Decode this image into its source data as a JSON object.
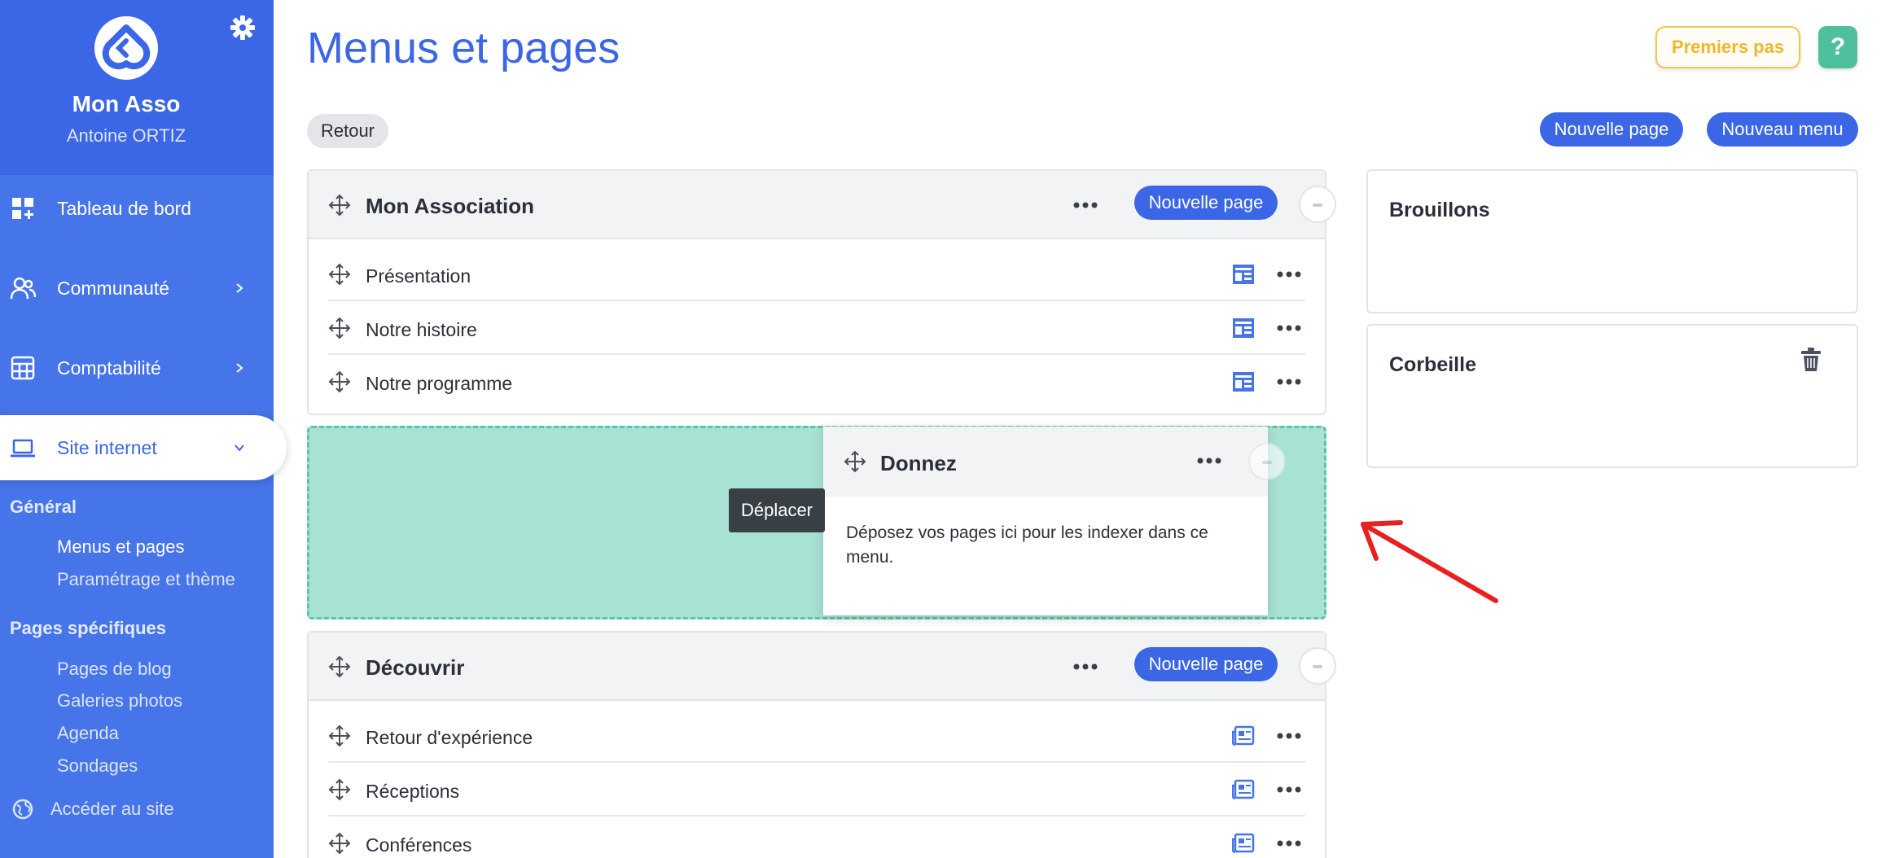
{
  "sidebar": {
    "org_name": "Mon Asso",
    "user_name": "Antoine ORTIZ",
    "nav": [
      {
        "label": "Tableau de bord",
        "icon": "dashboard-icon"
      },
      {
        "label": "Communauté",
        "icon": "community-icon"
      },
      {
        "label": "Comptabilité",
        "icon": "calculator-icon"
      },
      {
        "label": "Site internet",
        "icon": "laptop-icon"
      }
    ],
    "sections": [
      {
        "title": "Général",
        "links": [
          "Menus et pages",
          "Paramétrage et thème"
        ]
      },
      {
        "title": "Pages spécifiques",
        "links": [
          "Pages de blog",
          "Galeries photos",
          "Agenda",
          "Sondages"
        ]
      }
    ],
    "site_link": "Accéder au site"
  },
  "header": {
    "title": "Menus et pages",
    "premiers_pas": "Premiers pas",
    "help": "?"
  },
  "toolbar": {
    "retour": "Retour",
    "nouvelle_page": "Nouvelle page",
    "nouveau_menu": "Nouveau menu"
  },
  "menus": [
    {
      "title": "Mon Association",
      "button": "Nouvelle page",
      "items": [
        "Présentation",
        "Notre histoire",
        "Notre programme"
      ]
    },
    {
      "title": "Découvrir",
      "button": "Nouvelle page",
      "items": [
        "Retour d'expérience",
        "Réceptions",
        "Conférences"
      ]
    }
  ],
  "drag": {
    "title": "Donnez",
    "body": "Déposez vos pages ici pour les indexer dans ce menu.",
    "tooltip": "Déplacer"
  },
  "panels": {
    "brouillons": "Brouillons",
    "corbeille": "Corbeille"
  },
  "colors": {
    "accent": "#3b66e6",
    "drop_zone": "#a8e2d5",
    "annotation_arrow": "#e8201f"
  }
}
